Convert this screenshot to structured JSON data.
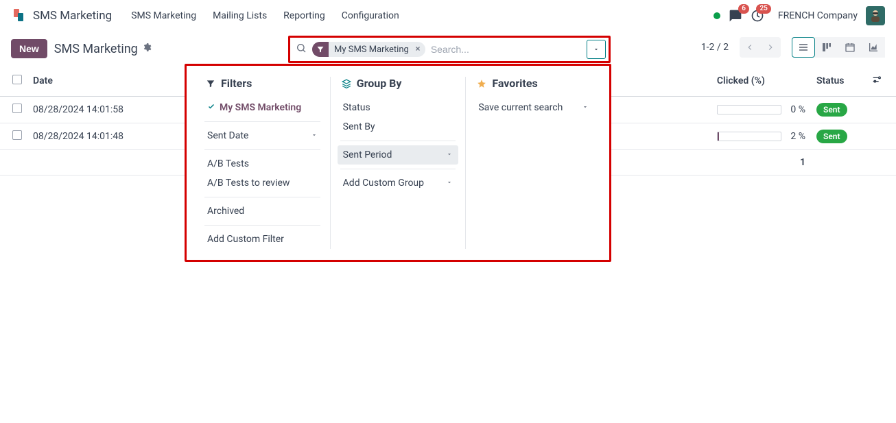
{
  "app_name": "SMS Marketing",
  "main_menu": [
    "SMS Marketing",
    "Mailing Lists",
    "Reporting",
    "Configuration"
  ],
  "systray": {
    "messages_badge": "6",
    "activities_badge": "25",
    "company": "FRENCH Company"
  },
  "breadcrumb": {
    "new_label": "New",
    "title": "SMS Marketing"
  },
  "search": {
    "facet_label": "My SMS Marketing",
    "placeholder": "Search..."
  },
  "pager": {
    "range": "1-2 / 2"
  },
  "columns": {
    "date": "Date",
    "clicked": "Clicked (%)",
    "status": "Status"
  },
  "rows": [
    {
      "date": "08/28/2024 14:01:58",
      "clicked_pct": "0 %",
      "progress_width": "0%",
      "status": "Sent"
    },
    {
      "date": "08/28/2024 14:01:48",
      "clicked_pct": "2 %",
      "progress_width": "2%",
      "status": "Sent"
    }
  ],
  "footer_count": "1",
  "panel": {
    "filters": {
      "header": "Filters",
      "my_sms": "My SMS Marketing",
      "sent_date": "Sent Date",
      "ab_tests": "A/B Tests",
      "ab_tests_review": "A/B Tests to review",
      "archived": "Archived",
      "add_custom": "Add Custom Filter"
    },
    "groupby": {
      "header": "Group By",
      "status": "Status",
      "sent_by": "Sent By",
      "sent_period": "Sent Period",
      "add_custom": "Add Custom Group"
    },
    "favorites": {
      "header": "Favorites",
      "save_current": "Save current search"
    }
  }
}
